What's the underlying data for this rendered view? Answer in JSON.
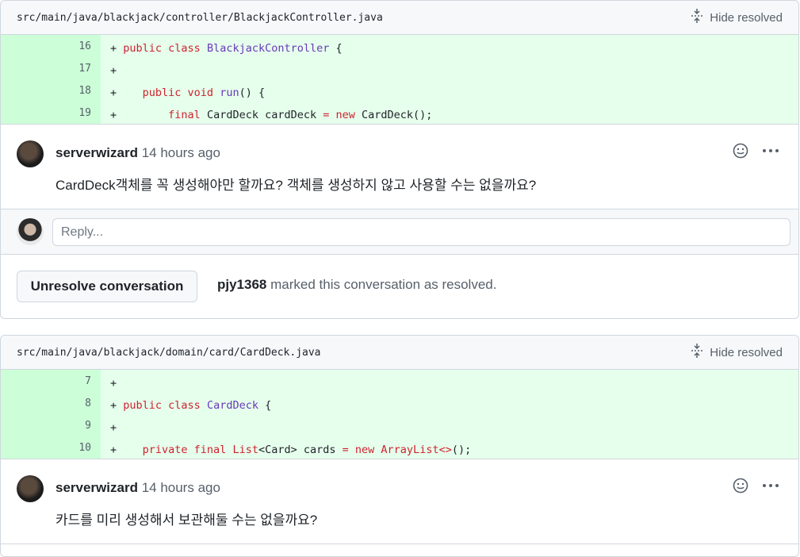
{
  "threads": [
    {
      "file_path": "src/main/java/blackjack/controller/BlackjackController.java",
      "hide_resolved_label": "Hide resolved",
      "lines": [
        {
          "num": "16",
          "tokens": [
            [
              "",
              "+ "
            ],
            [
              "kw",
              "public "
            ],
            [
              "kw",
              "class "
            ],
            [
              "cls",
              "BlackjackController"
            ],
            [
              "",
              " {"
            ]
          ]
        },
        {
          "num": "17",
          "tokens": [
            [
              "",
              "+"
            ]
          ]
        },
        {
          "num": "18",
          "tokens": [
            [
              "",
              "+    "
            ],
            [
              "kw",
              "public "
            ],
            [
              "kw",
              "void "
            ],
            [
              "cls",
              "run"
            ],
            [
              "",
              "() {"
            ]
          ]
        },
        {
          "num": "19",
          "tokens": [
            [
              "",
              "+        "
            ],
            [
              "kw",
              "final "
            ],
            [
              "",
              "CardDeck cardDeck "
            ],
            [
              "kw",
              "= "
            ],
            [
              "kw",
              "new "
            ],
            [
              "",
              "CardDeck();"
            ]
          ]
        }
      ],
      "comment": {
        "author": "serverwizard",
        "time": "14 hours ago",
        "body": "CardDeck객체를 꼭 생성해야만 할까요? 객체를 생성하지 않고 사용할 수는 없을까요?"
      },
      "reply_placeholder": "Reply...",
      "unresolve_label": "Unresolve conversation",
      "resolved_by": "pjy1368",
      "resolved_text": " marked this conversation as resolved."
    },
    {
      "file_path": "src/main/java/blackjack/domain/card/CardDeck.java",
      "hide_resolved_label": "Hide resolved",
      "lines": [
        {
          "num": "7",
          "tokens": [
            [
              "",
              "+"
            ]
          ]
        },
        {
          "num": "8",
          "tokens": [
            [
              "",
              "+ "
            ],
            [
              "kw",
              "public "
            ],
            [
              "kw",
              "class "
            ],
            [
              "cls",
              "CardDeck"
            ],
            [
              "",
              " {"
            ]
          ]
        },
        {
          "num": "9",
          "tokens": [
            [
              "",
              "+"
            ]
          ]
        },
        {
          "num": "10",
          "tokens": [
            [
              "",
              "+    "
            ],
            [
              "kw",
              "private "
            ],
            [
              "kw",
              "final "
            ],
            [
              "kw",
              "List"
            ],
            [
              "",
              "<Card> cards "
            ],
            [
              "kw",
              "= "
            ],
            [
              "kw",
              "new "
            ],
            [
              "kw",
              "ArrayList<>"
            ],
            [
              "",
              "();"
            ]
          ]
        }
      ],
      "comment": {
        "author": "serverwizard",
        "time": "14 hours ago",
        "body": "카드를 미리 생성해서 보관해둘 수는 없을까요?"
      }
    }
  ]
}
